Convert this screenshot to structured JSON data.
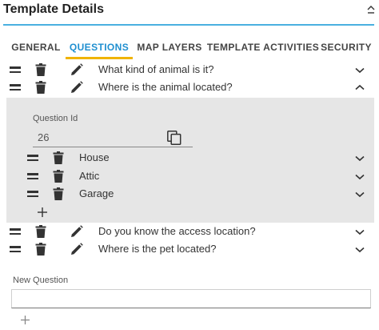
{
  "header": {
    "title": "Template Details"
  },
  "tabs": [
    {
      "label": "GENERAL",
      "active": false
    },
    {
      "label": "QUESTIONS",
      "active": true
    },
    {
      "label": "MAP LAYERS",
      "active": false
    },
    {
      "label": "TEMPLATE ACTIVITIES",
      "active": false
    },
    {
      "label": "SECURITY",
      "active": false
    }
  ],
  "questions": [
    {
      "text": "What kind of animal is it?",
      "expanded": false
    },
    {
      "text": "Where is the animal located?",
      "expanded": true
    },
    {
      "text": "Do you know the access location?",
      "expanded": false
    },
    {
      "text": "Where is the pet located?",
      "expanded": false
    }
  ],
  "expanded_question": {
    "id_label": "Question Id",
    "id_value": "26",
    "answers": [
      "House",
      "Attic",
      "Garage"
    ]
  },
  "new_question": {
    "label": "New Question",
    "value": ""
  },
  "colors": {
    "accent": "#1f8fd0",
    "tab_underline": "#f0b400",
    "header_rule": "#4ab0e0",
    "expanded_bg": "#e6e6e6"
  },
  "icons": [
    "collapse-icon",
    "drag-handle-icon",
    "trash-icon",
    "pencil-icon",
    "chevron-down-icon",
    "chevron-up-icon",
    "copy-icon",
    "plus-icon"
  ]
}
